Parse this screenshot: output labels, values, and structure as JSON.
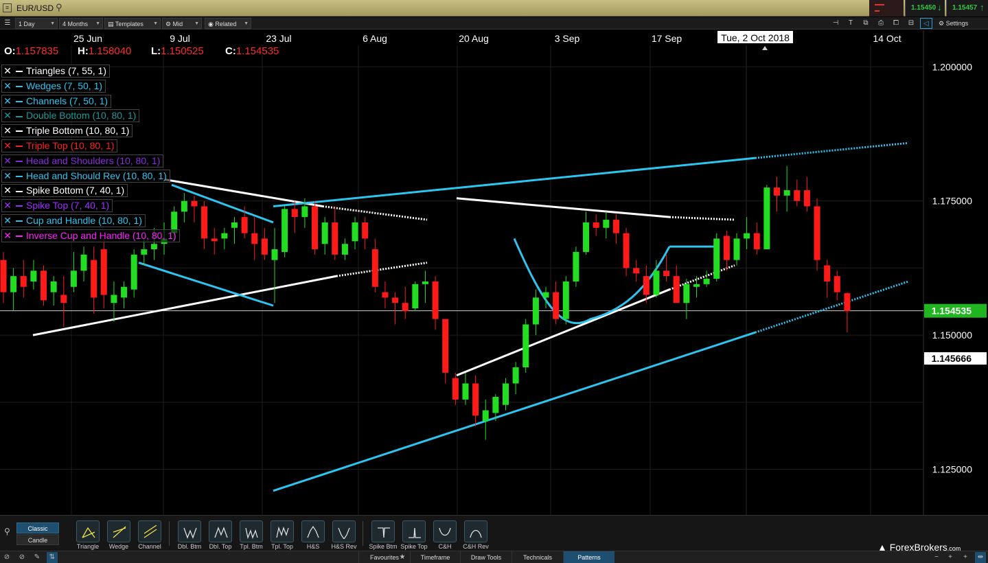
{
  "titlebar": {
    "symbol": "EUR/USD",
    "bid": "1.15450",
    "ask": "1.15457"
  },
  "toolbar": {
    "interval": "1 Day",
    "range": "4 Months",
    "templates": "Templates",
    "price_type": "Mid",
    "related": "Related",
    "settings": "Settings"
  },
  "ohlc": {
    "o_label": "O:",
    "o": "1.157835",
    "h_label": "H:",
    "h": "1.158040",
    "l_label": "L:",
    "l": "1.150525",
    "c_label": "C:",
    "c": "1.154535"
  },
  "legend": [
    {
      "label": "Triangles (7, 55, 1)",
      "color": "#ffffff"
    },
    {
      "label": "Wedges (7, 50, 1)",
      "color": "#2ec4f0"
    },
    {
      "label": "Channels (7, 50, 1)",
      "color": "#2ec4f0"
    },
    {
      "label": "Double Bottom (10, 80, 1)",
      "color": "#1a9a9a"
    },
    {
      "label": "Triple Bottom (10, 80, 1)",
      "color": "#ffffff"
    },
    {
      "label": "Triple Top (10, 80, 1)",
      "color": "#ff2020"
    },
    {
      "label": "Head and Shoulders (10, 80, 1)",
      "color": "#8a2be2"
    },
    {
      "label": "Head and Should Rev (10, 80, 1)",
      "color": "#2ec4f0"
    },
    {
      "label": "Spike Bottom (7, 40, 1)",
      "color": "#ffffff"
    },
    {
      "label": "Spike Top (7, 40, 1)",
      "color": "#9b30ff"
    },
    {
      "label": "Cup and Handle (10, 80, 1)",
      "color": "#2ec4f0"
    },
    {
      "label": "Inverse Cup and Handle (10, 80, 1)",
      "color": "#ff20ff"
    }
  ],
  "chart_data": {
    "type": "candlestick",
    "symbol": "EUR/USD",
    "x_tick_labels": [
      "25 Jun",
      "9 Jul",
      "23 Jul",
      "6 Aug",
      "20 Aug",
      "3 Sep",
      "17 Sep",
      "14 Oct"
    ],
    "crosshair_date": "Tue, 2 Oct 2018",
    "y_tick_labels": [
      "1.200000",
      "1.175000",
      "1.150000",
      "1.125000"
    ],
    "ylim": [
      1.1165,
      1.204
    ],
    "last_price": "1.154535",
    "marker_price": "1.145666",
    "grid": true,
    "candles": [
      [
        1.164,
        1.1655,
        1.156,
        1.158
      ],
      [
        1.158,
        1.1625,
        1.1545,
        1.161
      ],
      [
        1.161,
        1.164,
        1.157,
        1.159
      ],
      [
        1.16,
        1.164,
        1.1585,
        1.162
      ],
      [
        1.162,
        1.163,
        1.1555,
        1.1565
      ],
      [
        1.158,
        1.161,
        1.1555,
        1.16
      ],
      [
        1.1575,
        1.161,
        1.1515,
        1.156
      ],
      [
        1.159,
        1.1655,
        1.158,
        1.162
      ],
      [
        1.162,
        1.1665,
        1.16,
        1.165
      ],
      [
        1.164,
        1.1665,
        1.154,
        1.157
      ],
      [
        1.166,
        1.168,
        1.155,
        1.1575
      ],
      [
        1.156,
        1.16,
        1.1525,
        1.1575
      ],
      [
        1.157,
        1.16,
        1.155,
        1.159
      ],
      [
        1.1585,
        1.166,
        1.157,
        1.165
      ],
      [
        1.165,
        1.168,
        1.163,
        1.166
      ],
      [
        1.166,
        1.17,
        1.164,
        1.167
      ],
      [
        1.167,
        1.171,
        1.165,
        1.168
      ],
      [
        1.169,
        1.174,
        1.1675,
        1.173
      ],
      [
        1.173,
        1.1765,
        1.171,
        1.175
      ],
      [
        1.175,
        1.176,
        1.171,
        1.174
      ],
      [
        1.174,
        1.175,
        1.166,
        1.168
      ],
      [
        1.168,
        1.17,
        1.165,
        1.1675
      ],
      [
        1.168,
        1.17,
        1.166,
        1.169
      ],
      [
        1.17,
        1.172,
        1.167,
        1.171
      ],
      [
        1.172,
        1.174,
        1.168,
        1.169
      ],
      [
        1.169,
        1.172,
        1.164,
        1.167
      ],
      [
        1.168,
        1.17,
        1.164,
        1.165
      ],
      [
        1.164,
        1.17,
        1.156,
        1.166
      ],
      [
        1.1655,
        1.174,
        1.1645,
        1.1735
      ],
      [
        1.1735,
        1.175,
        1.169,
        1.172
      ],
      [
        1.172,
        1.1755,
        1.17,
        1.174
      ],
      [
        1.174,
        1.175,
        1.165,
        1.166
      ],
      [
        1.167,
        1.172,
        1.165,
        1.171
      ],
      [
        1.171,
        1.174,
        1.164,
        1.165
      ],
      [
        1.165,
        1.168,
        1.164,
        1.167
      ],
      [
        1.1675,
        1.172,
        1.166,
        1.171
      ],
      [
        1.171,
        1.172,
        1.166,
        1.168
      ],
      [
        1.166,
        1.168,
        1.158,
        1.159
      ],
      [
        1.158,
        1.16,
        1.155,
        1.157
      ],
      [
        1.157,
        1.158,
        1.152,
        1.156
      ],
      [
        1.156,
        1.159,
        1.153,
        1.1545
      ],
      [
        1.155,
        1.16,
        1.1545,
        1.1595
      ],
      [
        1.1595,
        1.162,
        1.156,
        1.16
      ],
      [
        1.16,
        1.161,
        1.151,
        1.153
      ],
      [
        1.153,
        1.153,
        1.141,
        1.143
      ],
      [
        1.142,
        1.143,
        1.137,
        1.138
      ],
      [
        1.138,
        1.143,
        1.137,
        1.141
      ],
      [
        1.141,
        1.1425,
        1.133,
        1.135
      ],
      [
        1.134,
        1.138,
        1.1305,
        1.136
      ],
      [
        1.1355,
        1.139,
        1.134,
        1.1385
      ],
      [
        1.137,
        1.142,
        1.136,
        1.141
      ],
      [
        1.141,
        1.145,
        1.139,
        1.144
      ],
      [
        1.144,
        1.153,
        1.143,
        1.152
      ],
      [
        1.152,
        1.1585,
        1.15,
        1.157
      ],
      [
        1.157,
        1.159,
        1.155,
        1.158
      ],
      [
        1.158,
        1.16,
        1.152,
        1.153
      ],
      [
        1.153,
        1.161,
        1.152,
        1.16
      ],
      [
        1.16,
        1.1665,
        1.159,
        1.1655
      ],
      [
        1.1655,
        1.173,
        1.165,
        1.171
      ],
      [
        1.171,
        1.1725,
        1.1685,
        1.17
      ],
      [
        1.17,
        1.173,
        1.168,
        1.1715
      ],
      [
        1.1715,
        1.1725,
        1.167,
        1.169
      ],
      [
        1.169,
        1.17,
        1.161,
        1.1625
      ],
      [
        1.1625,
        1.164,
        1.16,
        1.1615
      ],
      [
        1.161,
        1.163,
        1.156,
        1.1575
      ],
      [
        1.1575,
        1.164,
        1.157,
        1.162
      ],
      [
        1.162,
        1.165,
        1.16,
        1.161
      ],
      [
        1.161,
        1.163,
        1.156,
        1.156
      ],
      [
        1.156,
        1.1605,
        1.153,
        1.1595
      ],
      [
        1.159,
        1.161,
        1.157,
        1.1595
      ],
      [
        1.1595,
        1.162,
        1.159,
        1.1605
      ],
      [
        1.1605,
        1.169,
        1.16,
        1.168
      ],
      [
        1.1685,
        1.1695,
        1.162,
        1.164
      ],
      [
        1.164,
        1.169,
        1.163,
        1.168
      ],
      [
        1.168,
        1.172,
        1.166,
        1.169
      ],
      [
        1.169,
        1.171,
        1.165,
        1.166
      ],
      [
        1.166,
        1.178,
        1.166,
        1.1775
      ],
      [
        1.1775,
        1.1795,
        1.173,
        1.176
      ],
      [
        1.176,
        1.1815,
        1.173,
        1.177
      ],
      [
        1.177,
        1.179,
        1.174,
        1.175
      ],
      [
        1.177,
        1.1795,
        1.173,
        1.174
      ],
      [
        1.174,
        1.1755,
        1.162,
        1.164
      ],
      [
        1.163,
        1.164,
        1.157,
        1.16
      ],
      [
        1.161,
        1.162,
        1.1565,
        1.158
      ],
      [
        1.1578,
        1.158,
        1.1505,
        1.1545
      ]
    ]
  },
  "pattern_bar": {
    "mode_classic": "Classic",
    "mode_candle": "Candle",
    "buttons": [
      {
        "label": "Triangle"
      },
      {
        "label": "Wedge"
      },
      {
        "label": "Channel"
      },
      {
        "label": "Dbl. Btm"
      },
      {
        "label": "Dbl. Top"
      },
      {
        "label": "Tpl. Btm"
      },
      {
        "label": "Tpl. Top"
      },
      {
        "label": "H&S"
      },
      {
        "label": "H&S Rev"
      },
      {
        "label": "Spike Btm"
      },
      {
        "label": "Spike Top"
      },
      {
        "label": "C&H"
      },
      {
        "label": "C&H Rev"
      }
    ]
  },
  "status_tabs": [
    "Favourites",
    "Timeframe",
    "Draw Tools",
    "Technicals",
    "Patterns"
  ],
  "brand": {
    "name": "ForexBrokers",
    "suffix": ".com"
  }
}
